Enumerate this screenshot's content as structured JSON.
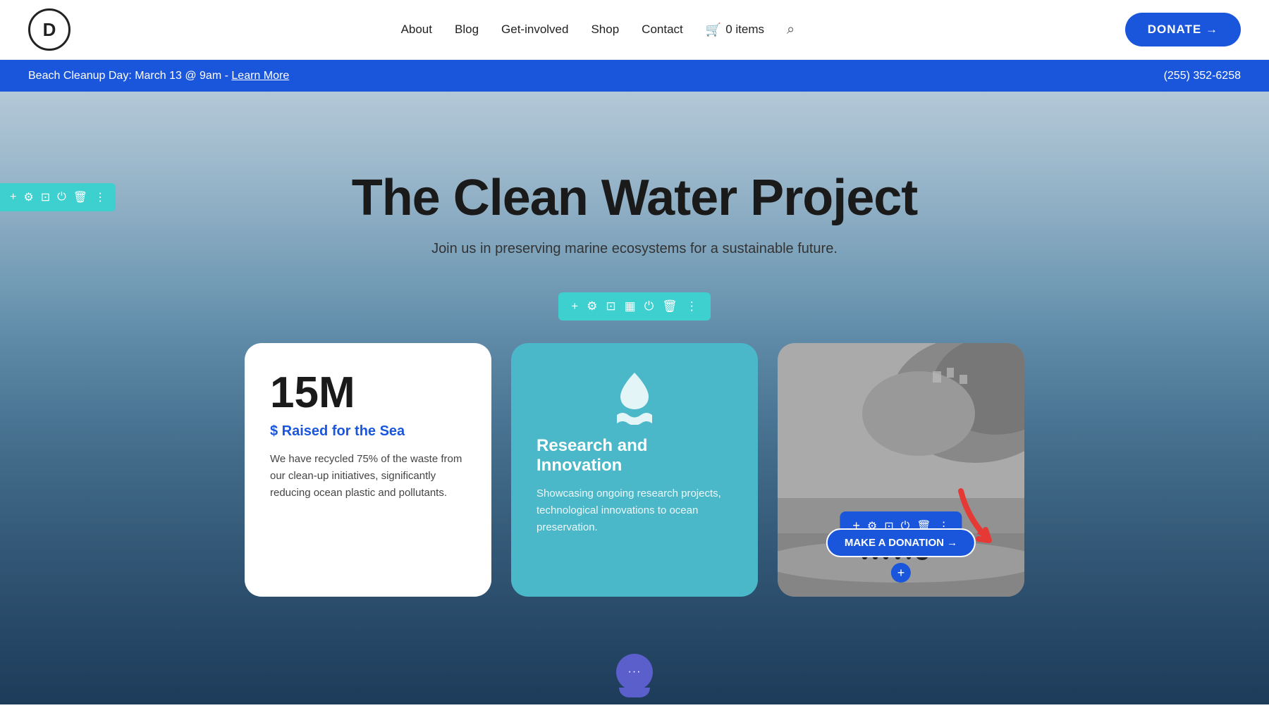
{
  "header": {
    "logo_letter": "D",
    "nav": {
      "items": [
        "About",
        "Blog",
        "Get-involved",
        "Shop",
        "Contact"
      ]
    },
    "cart": {
      "icon": "🛒",
      "label": "0 items"
    },
    "search_icon": "○",
    "donate_label": "DONATE →"
  },
  "announcement": {
    "text": "Beach Cleanup Day: March 13 @ 9am -",
    "link_label": "Learn More",
    "phone": "(255) 352-6258"
  },
  "editor_toolbar_top": {
    "icons": [
      "+",
      "⚙",
      "⊡",
      "⏻",
      "🗑",
      "⋮"
    ]
  },
  "hero": {
    "title": "The Clean Water Project",
    "subtitle": "Join us in preserving marine ecosystems for a sustainable future."
  },
  "section_toolbar": {
    "icons": [
      "+",
      "⚙",
      "⊡",
      "▦",
      "⏻",
      "🗑",
      "⋮"
    ]
  },
  "cards": [
    {
      "type": "stat",
      "stat": "15M",
      "subtitle": "$ Raised for the Sea",
      "body": "We have recycled 75% of the waste from our clean-up initiatives, significantly reducing ocean plastic and pollutants."
    },
    {
      "type": "teal",
      "icon": "💧",
      "title": "Research and Innovation",
      "body": "Showcasing ongoing research projects, technological innovations to ocean preservation."
    },
    {
      "type": "image",
      "donate_btn": "MAKE A DONATION →",
      "bottom_plus": "+"
    }
  ],
  "chatbot": {
    "emoji": "···"
  }
}
